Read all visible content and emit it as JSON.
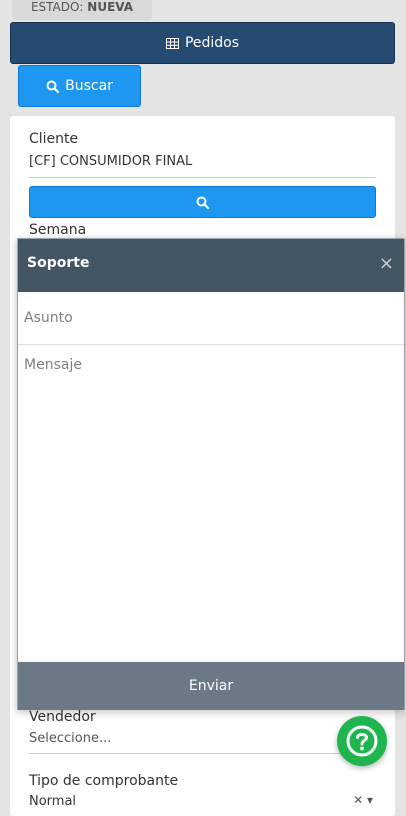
{
  "status": {
    "label": "ESTADO:",
    "value": "NUEVA"
  },
  "toolbar": {
    "pedidos_label": "Pedidos",
    "buscar_label": "Buscar"
  },
  "form": {
    "cliente_label": "Cliente",
    "cliente_value": "[CF] CONSUMIDOR FINAL",
    "semana_label": "Semana",
    "vendedor_label": "Vendedor",
    "vendedor_value": "Seleccione...",
    "tipo_label": "Tipo de comprobante",
    "tipo_value": "Normal"
  },
  "modal": {
    "title": "Soporte",
    "close": "×",
    "asunto_placeholder": "Asunto",
    "mensaje_placeholder": "Mensaje",
    "send_label": "Enviar"
  },
  "colors": {
    "primary_dark": "#264b73",
    "primary": "#1d97f0",
    "modal_header": "#445564",
    "send": "#6b7885",
    "help": "#1eb54e"
  },
  "icons": {
    "pedidos": "grid-icon",
    "buscar": "search-icon",
    "help": "question-icon"
  }
}
